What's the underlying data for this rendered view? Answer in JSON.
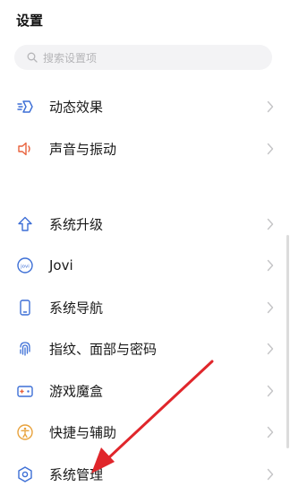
{
  "header": {
    "title": "设置"
  },
  "search": {
    "placeholder": "搜索设置项",
    "icon": "search-icon"
  },
  "menu": {
    "items": [
      {
        "label": "动态效果",
        "icon": "motion-effect-icon",
        "color": "#3d6fd6"
      },
      {
        "label": "声音与振动",
        "icon": "speaker-icon",
        "color": "#e8613c"
      },
      {
        "label": "系统升级",
        "icon": "upgrade-arrow-icon",
        "color": "#3d6fd6"
      },
      {
        "label": "Jovi",
        "icon": "jovi-icon",
        "color": "#3d6fd6"
      },
      {
        "label": "系统导航",
        "icon": "phone-navigation-icon",
        "color": "#3d6fd6"
      },
      {
        "label": "指纹、面部与密码",
        "icon": "fingerprint-icon",
        "color": "#3d6fd6"
      },
      {
        "label": "游戏魔盒",
        "icon": "game-box-icon",
        "color": "#3d6fd6"
      },
      {
        "label": "快捷与辅助",
        "icon": "accessibility-icon",
        "color": "#e8a23c"
      },
      {
        "label": "系统管理",
        "icon": "system-management-icon",
        "color": "#3d6fd6"
      }
    ]
  },
  "annotation": {
    "arrow_color": "#e0262b"
  }
}
